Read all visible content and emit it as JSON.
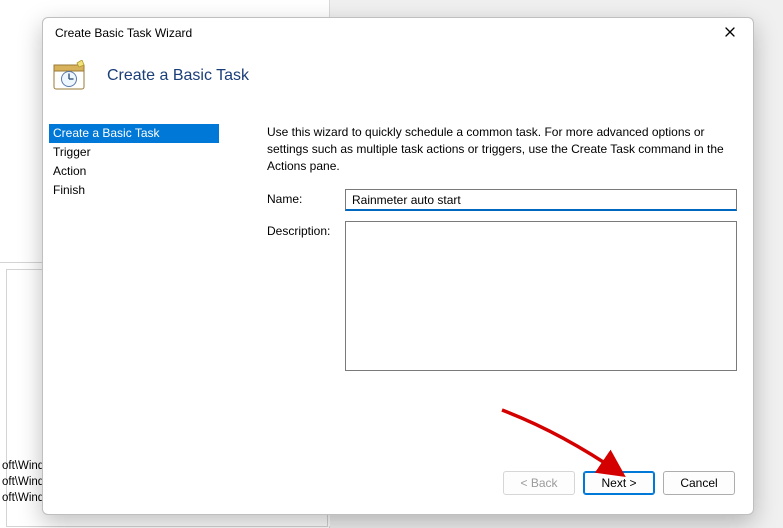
{
  "window": {
    "title": "Create Basic Task Wizard",
    "heading": "Create a Basic Task"
  },
  "nav": {
    "items": [
      {
        "label": "Create a Basic Task",
        "selected": true
      },
      {
        "label": "Trigger",
        "selected": false
      },
      {
        "label": "Action",
        "selected": false
      },
      {
        "label": "Finish",
        "selected": false
      }
    ]
  },
  "content": {
    "intro": "Use this wizard to quickly schedule a common task.  For more advanced options or settings such as multiple task actions or triggers, use the Create Task command in the Actions pane.",
    "name_label": "Name:",
    "name_value": "Rainmeter auto start",
    "description_label": "Description:",
    "description_value": ""
  },
  "footer": {
    "back_label": "< Back",
    "next_label": "Next >",
    "cancel_label": "Cancel"
  },
  "background_paths": [
    "oft\\Wind…",
    "oft\\Windows\\U…",
    "oft\\Windows\\Fli…"
  ]
}
